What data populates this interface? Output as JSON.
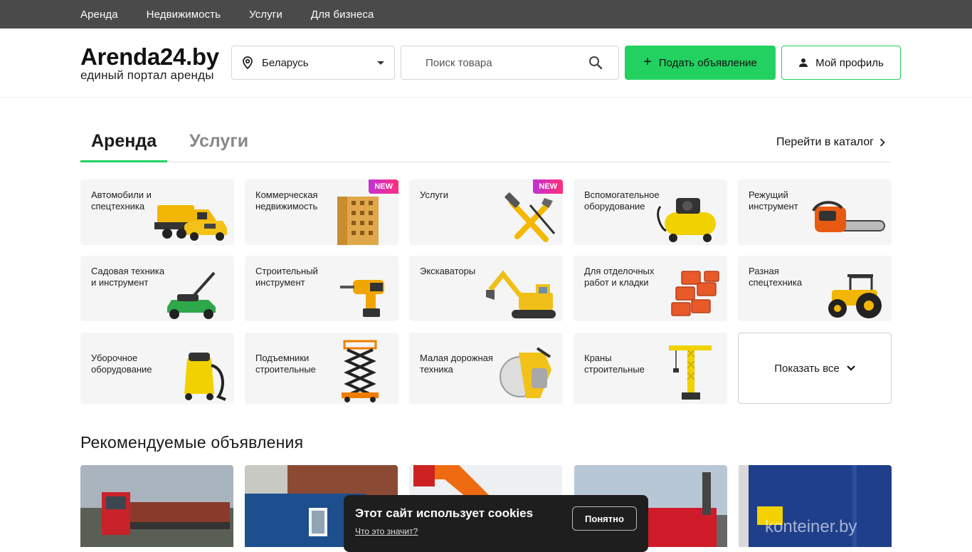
{
  "topnav": [
    "Аренда",
    "Недвижимость",
    "Услуги",
    "Для бизнеса"
  ],
  "logo": {
    "name": "Arenda24.by",
    "tagline": "единый портал аренды"
  },
  "region": {
    "value": "Беларусь"
  },
  "search": {
    "placeholder": "Поиск товара"
  },
  "buttons": {
    "post": "Подать объявление",
    "profile": "Мой профиль"
  },
  "tabs": {
    "active": "Аренда",
    "inactive": "Услуги",
    "catalog": "Перейти в каталог"
  },
  "categories": [
    {
      "label": "Автомобили и спецтехника",
      "badge": "",
      "icon": "truck-icon"
    },
    {
      "label": "Коммерческая недвижимость",
      "badge": "NEW",
      "icon": "building-icon"
    },
    {
      "label": "Услуги",
      "badge": "NEW",
      "icon": "tools-icon"
    },
    {
      "label": "Вспомогательное оборудование",
      "badge": "",
      "icon": "compressor-icon"
    },
    {
      "label": "Режущий инструмент",
      "badge": "",
      "icon": "chainsaw-icon"
    },
    {
      "label": "Садовая техника и инструмент",
      "badge": "",
      "icon": "lawnmower-icon"
    },
    {
      "label": "Строительный инструмент",
      "badge": "",
      "icon": "drill-icon"
    },
    {
      "label": "Экскаваторы",
      "badge": "",
      "icon": "excavator-icon"
    },
    {
      "label": "Для отделочных работ и кладки",
      "badge": "",
      "icon": "bricks-icon"
    },
    {
      "label": "Разная спецтехника",
      "badge": "",
      "icon": "tractor-icon"
    },
    {
      "label": "Уборочное оборудование",
      "badge": "",
      "icon": "vacuum-icon"
    },
    {
      "label": "Подъемники строительные",
      "badge": "",
      "icon": "scissor-lift-icon"
    },
    {
      "label": "Малая дорожная техника",
      "badge": "",
      "icon": "road-saw-icon"
    },
    {
      "label": "Краны строительные",
      "badge": "",
      "icon": "crane-icon"
    }
  ],
  "show_all": "Показать все",
  "recommended_title": "Рекомендуемые объявления",
  "watermark": "konteiner.by",
  "cookie": {
    "title": "Этот сайт использует cookies",
    "link": "Что это значит?",
    "ok": "Понятно"
  },
  "colors": {
    "accent": "#22d160",
    "topbar": "#4a4a4a",
    "badge_from": "#c231d6",
    "badge_to": "#ff2f7a"
  }
}
